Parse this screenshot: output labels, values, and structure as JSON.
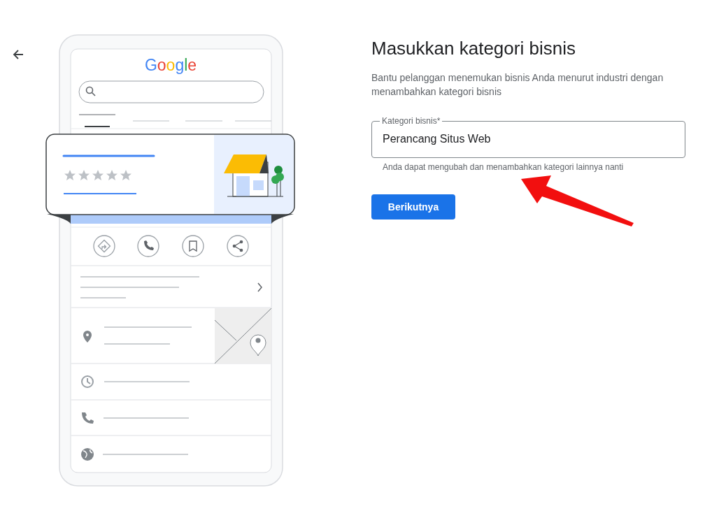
{
  "illustration": {
    "logo_letters": [
      {
        "text": "G",
        "color": "#4285f4"
      },
      {
        "text": "o",
        "color": "#ea4335"
      },
      {
        "text": "o",
        "color": "#fbbc04"
      },
      {
        "text": "g",
        "color": "#4285f4"
      },
      {
        "text": "l",
        "color": "#34a853"
      },
      {
        "text": "e",
        "color": "#ea4335"
      }
    ]
  },
  "form": {
    "title": "Masukkan kategori bisnis",
    "description": "Bantu pelanggan menemukan bisnis Anda menurut industri dengan menambahkan kategori bisnis",
    "field": {
      "label": "Kategori bisnis*",
      "value": "Perancang Situs Web",
      "helper": "Anda dapat mengubah dan menambahkan kategori lainnya nanti"
    },
    "button": "Berikutnya"
  }
}
